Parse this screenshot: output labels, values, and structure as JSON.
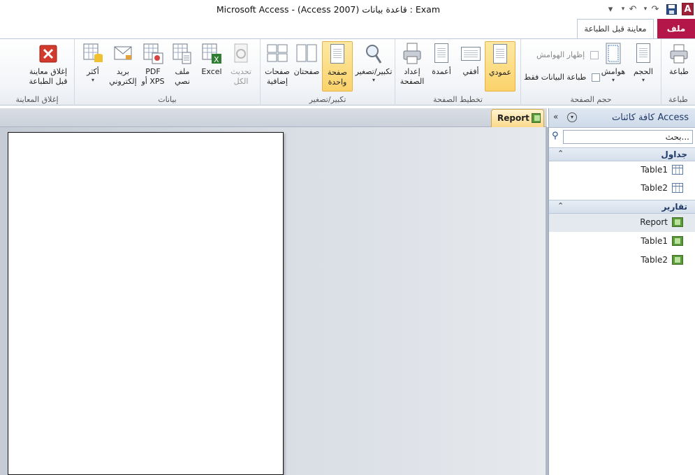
{
  "window": {
    "title": "Microsoft Access - (Access 2007) قاعدة بيانات : Exam"
  },
  "quick_access": {
    "access_logo": "A",
    "customize": "▾"
  },
  "tabs": {
    "file": "ملف",
    "print_preview": "معاينة قبل الطباعة"
  },
  "ribbon": {
    "print_group": {
      "label": "طباعة",
      "print": "طباعة"
    },
    "page_size_group": {
      "label": "حجم الصفحة",
      "size": "الحجم",
      "margins": "هوامش",
      "show_margins": "إظهار الهوامش",
      "print_data_only": "طباعة البيانات فقط"
    },
    "page_layout_group": {
      "label": "تخطيط الصفحة",
      "portrait": "عمودي",
      "landscape": "أفقي",
      "columns": "أعمدة",
      "page_setup": "إعداد\nالصفحة"
    },
    "zoom_group": {
      "label": "تكبير/تصغير",
      "zoom": "تكبير/تصغير",
      "one_page": "صفحة\nواحدة",
      "two_pages": "صفحتان",
      "more_pages": "صفحات\nإضافية"
    },
    "data_group": {
      "label": "بيانات",
      "refresh_all": "تحديث\nالكل",
      "excel": "Excel",
      "text_file": "ملف\nنصي",
      "pdf_xps": "PDF\nأو XPS",
      "email": "بريد\nإلكتروني",
      "more": "أكثر"
    },
    "close_group": {
      "label": "إغلاق المعاينة",
      "close_preview": "إغلاق معاينة\nقبل الطباعة"
    }
  },
  "nav": {
    "title": "كافة كائنات Access",
    "search_placeholder": "بحث...",
    "sections": [
      {
        "title": "جداول",
        "items": [
          "Table1",
          "Table2"
        ]
      },
      {
        "title": "تقارير",
        "items": [
          "Report",
          "Table1",
          "Table2"
        ]
      }
    ]
  },
  "document": {
    "tab_label": "Report"
  },
  "colors": {
    "file_tab": "#b5164a",
    "selected_button": "#fbd26a",
    "nav_header": "#1f3a66"
  }
}
